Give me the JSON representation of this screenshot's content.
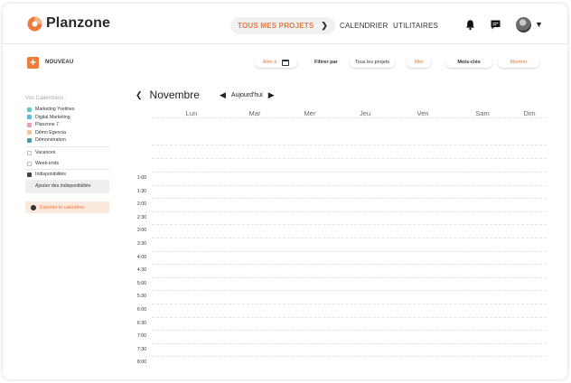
{
  "header": {
    "brand": "Planzone",
    "nav_projects": "TOUS MES PROJETS",
    "nav_calendar": "CALENDRIER",
    "nav_utilities": "UTILITAIRES"
  },
  "toolbar": {
    "new_label": "NOUVEAU",
    "goto_label": "Aller à",
    "filter_label": "Filtrer par",
    "all_projects": "Tous les projets",
    "mini_label": "Mini",
    "keywords_label": "Mots-clés",
    "show_label": "Montrer"
  },
  "sidebar": {
    "title": "Vos Calendriers :",
    "calendars": [
      {
        "label": "Marketing Yvelines",
        "color": "#6cc6c9"
      },
      {
        "label": "Digital Marketing",
        "color": "#5fb8d6"
      },
      {
        "label": "Planzone 7",
        "color": "#e6a0b2"
      },
      {
        "label": "Démo Egencia",
        "color": "#f2c49c"
      },
      {
        "label": "Démonstration",
        "color": "#4d9aa6"
      }
    ],
    "vacations": "Vacances",
    "weekends": "Week-ends",
    "unavailabilities": "Indisponibilités",
    "add_unavailabilities": "Ajouter des indisponibilités",
    "export": "Exporter le calendrier"
  },
  "calendar": {
    "month": "Novembre",
    "today": "Aujourd'hui",
    "days": [
      "Lun",
      "Mar",
      "Mer",
      "Jeu",
      "Ven",
      "Sam",
      "Dim"
    ],
    "hours": [
      "1:00",
      "1:30",
      "2:00",
      "2:30",
      "3:00",
      "3:30",
      "4:00",
      "4:30",
      "5:00",
      "5:30",
      "6:00",
      "6:30",
      "7:00",
      "7:30",
      "8:00"
    ]
  },
  "colors": {
    "accent": "#e8773a"
  }
}
